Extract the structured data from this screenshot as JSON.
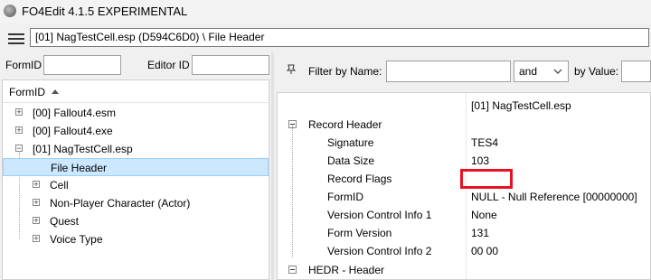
{
  "window": {
    "title": "FO4Edit 4.1.5 EXPERIMENTAL"
  },
  "path_field": {
    "value": "[01] NagTestCell.esp (D594C6D0) \\ File Header"
  },
  "left_toolbar": {
    "formid_label": "FormID",
    "formid_value": "",
    "editorid_label": "Editor ID",
    "editorid_value": ""
  },
  "tree": {
    "column_header": "FormID",
    "items": [
      {
        "label": "[00] Fallout4.esm",
        "level": 0
      },
      {
        "label": "[00] Fallout4.exe",
        "level": 0
      },
      {
        "label": "[01] NagTestCell.esp",
        "level": 0
      },
      {
        "label": "File Header",
        "level": 1
      },
      {
        "label": "Cell",
        "level": 1
      },
      {
        "label": "Non-Player Character (Actor)",
        "level": 1
      },
      {
        "label": "Quest",
        "level": 1
      },
      {
        "label": "Voice Type",
        "level": 1
      }
    ]
  },
  "filter_bar": {
    "filter_by_name_label": "Filter by Name:",
    "name_value": "",
    "operator_value": "and",
    "filter_by_value_label": "by Value:",
    "value_value": ""
  },
  "record_view": {
    "column_header_value": "[01] NagTestCell.esp",
    "rows": [
      {
        "name": "Record Header",
        "value": ""
      },
      {
        "name": "Signature",
        "value": "TES4"
      },
      {
        "name": "Data Size",
        "value": "103"
      },
      {
        "name": "Record Flags",
        "value": ""
      },
      {
        "name": "FormID",
        "value": "NULL - Null Reference [00000000]"
      },
      {
        "name": "Version Control Info 1",
        "value": "None"
      },
      {
        "name": "Form Version",
        "value": "131"
      },
      {
        "name": "Version Control Info 2",
        "value": "00 00"
      },
      {
        "name": "HEDR - Header",
        "value": ""
      }
    ]
  },
  "colors": {
    "selection": "#cce8ff",
    "highlight": "#e81123"
  }
}
